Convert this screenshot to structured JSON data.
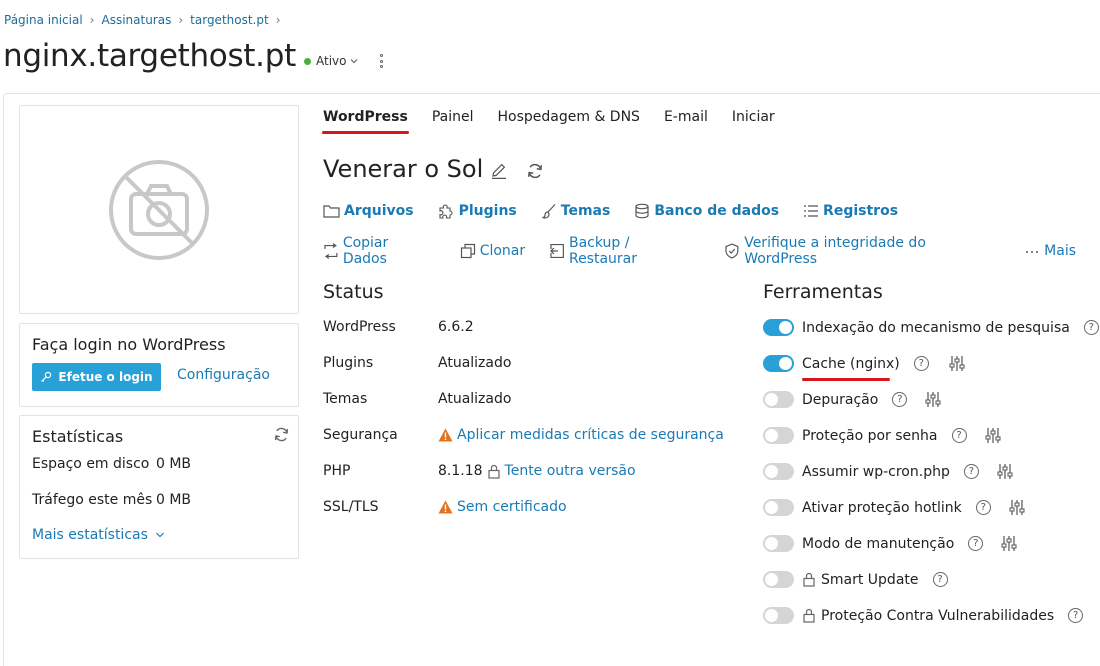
{
  "breadcrumb": [
    "Página inicial",
    "Assinaturas",
    "targethost.pt"
  ],
  "breadcrumb_sep": "›",
  "title": "nginx.targethost.pt",
  "status": {
    "label": "Ativo",
    "color": "#4caf3b"
  },
  "login_box": {
    "title": "Faça login no WordPress",
    "login_button": "Efetue o login",
    "config_link": "Configuração"
  },
  "stats": {
    "title": "Estatísticas",
    "disk_label": "Espaço em disco",
    "disk_value": "0 MB",
    "traffic_label": "Tráfego este mês",
    "traffic_value": "0 MB",
    "more_label": "Mais estatísticas"
  },
  "tabs": [
    {
      "label": "WordPress",
      "active": true
    },
    {
      "label": "Painel"
    },
    {
      "label": "Hospedagem & DNS"
    },
    {
      "label": "E-mail"
    },
    {
      "label": "Iniciar"
    }
  ],
  "site_title": "Venerar o Sol",
  "primary_actions": [
    {
      "label": "Arquivos",
      "icon": "folder-icon"
    },
    {
      "label": "Plugins",
      "icon": "puzzle-icon"
    },
    {
      "label": "Temas",
      "icon": "brush-icon"
    },
    {
      "label": "Banco de dados",
      "icon": "database-icon"
    },
    {
      "label": "Registros",
      "icon": "list-icon"
    }
  ],
  "secondary_actions": [
    {
      "label": "Copiar Dados",
      "icon": "copy-data-icon"
    },
    {
      "label": "Clonar",
      "icon": "clone-icon"
    },
    {
      "label": "Backup / Restaurar",
      "icon": "backup-icon"
    },
    {
      "label": "Verifique a integridade do WordPress",
      "icon": "shield-check-icon"
    },
    {
      "label": "Mais",
      "icon": "ellipsis-icon"
    }
  ],
  "status_section": {
    "title": "Status",
    "rows": [
      {
        "label": "WordPress",
        "value": "6.6.2"
      },
      {
        "label": "Plugins",
        "value": "Atualizado"
      },
      {
        "label": "Temas",
        "value": "Atualizado"
      },
      {
        "label": "Segurança",
        "value": "Aplicar medidas críticas de segurança"
      },
      {
        "label": "PHP",
        "value": "8.1.18",
        "link": "Tente outra versão"
      },
      {
        "label": "SSL/TLS",
        "value": "Sem certificado"
      }
    ]
  },
  "tools": {
    "title": "Ferramentas",
    "items": [
      {
        "label": "Indexação do mecanismo de pesquisa",
        "on": true
      },
      {
        "label": "Cache (nginx)",
        "on": true
      },
      {
        "label": "Depuração",
        "on": false
      },
      {
        "label": "Proteção por senha",
        "on": false
      },
      {
        "label": "Assumir wp-cron.php",
        "on": false
      },
      {
        "label": "Ativar proteção hotlink",
        "on": false
      },
      {
        "label": "Modo de manutenção",
        "on": false
      },
      {
        "label": "Smart Update",
        "on": false
      },
      {
        "label": "Proteção Contra Vulnerabilidades",
        "on": false
      }
    ]
  },
  "help_glyph": "?",
  "colors": {
    "accent": "#28a0d8",
    "link": "#1b7ab3",
    "active_tab": "#d6161b",
    "warning": "#e2731c"
  }
}
